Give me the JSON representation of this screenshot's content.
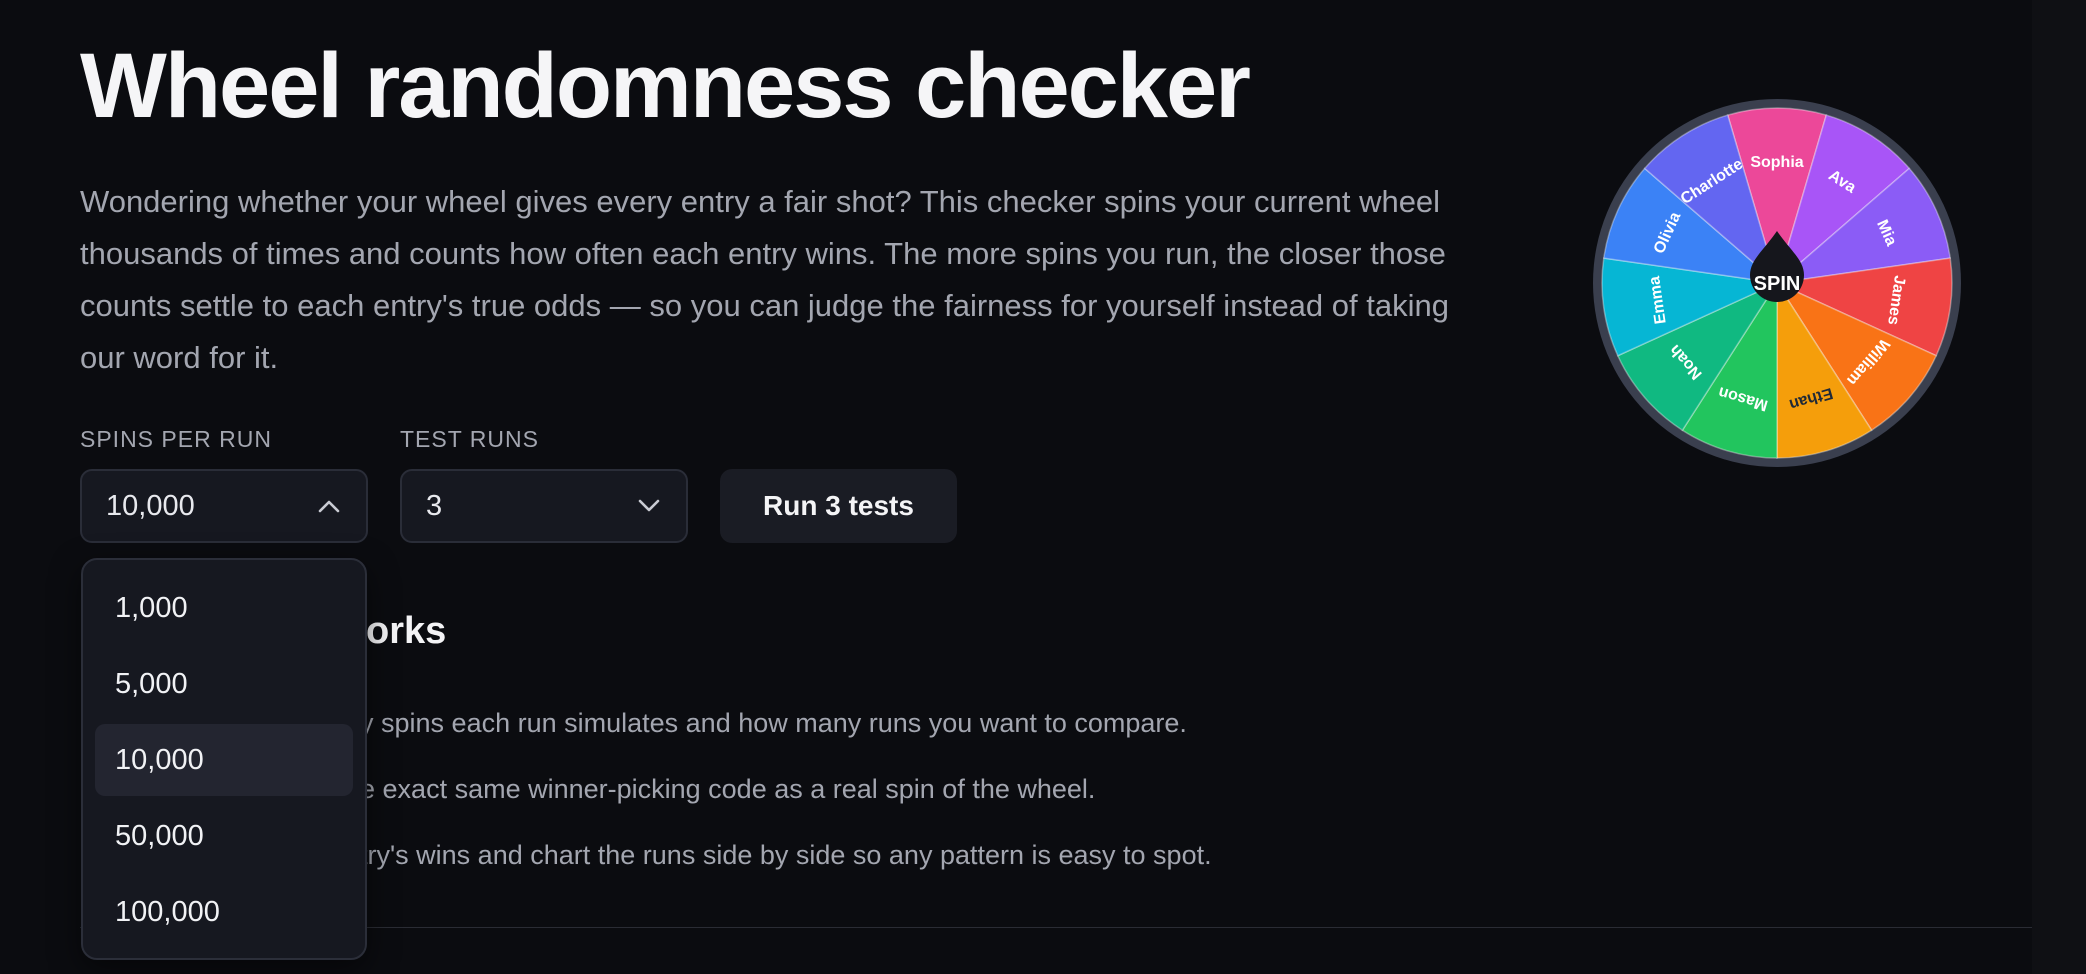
{
  "page": {
    "title": "Wheel randomness checker",
    "intro": "Wondering whether your wheel gives every entry a fair shot? This checker spins your current wheel thousands of times and counts how often each entry wins. The more spins you run, the closer those counts settle to each entry's true odds — so you can judge the fairness for yourself instead of taking our word for it."
  },
  "controls": {
    "spins_label": "SPINS PER RUN",
    "spins_value": "10,000",
    "runs_label": "TEST RUNS",
    "runs_value": "3",
    "run_button": "Run 3 tests"
  },
  "dropdown": {
    "options": [
      "1,000",
      "5,000",
      "10,000",
      "50,000",
      "100,000"
    ],
    "selected": "10,000"
  },
  "how_it_works": {
    "heading_visible": "orks",
    "steps_visible": [
      "ny spins each run simulates and how many runs you want to compare.",
      "he exact same winner-picking code as a real spin of the wheel.",
      "ntry's wins and chart the runs side by side so any pattern is easy to spot."
    ]
  },
  "wheel": {
    "center_label": "SPIN",
    "entries": [
      {
        "name": "Sophia",
        "color": "#ec4899"
      },
      {
        "name": "Ava",
        "color": "#a855f7"
      },
      {
        "name": "Mia",
        "color": "#8b5cf6"
      },
      {
        "name": "James",
        "color": "#ef4444"
      },
      {
        "name": "William",
        "color": "#f97316"
      },
      {
        "name": "Ethan",
        "color": "#f59e0b"
      },
      {
        "name": "Mason",
        "color": "#22c55e"
      },
      {
        "name": "Noah",
        "color": "#10b981"
      },
      {
        "name": "Emma",
        "color": "#06b6d4"
      },
      {
        "name": "Olivia",
        "color": "#3b82f6"
      },
      {
        "name": "Charlotte",
        "color": "#6366f1"
      }
    ],
    "label_color_light": "#ffffff",
    "label_color_dark": "#1f2937"
  },
  "theme": {
    "background": "#0b0c10",
    "text_primary": "#f5f5f7",
    "text_muted": "#a3a6b0",
    "control_bg": "#161820"
  }
}
